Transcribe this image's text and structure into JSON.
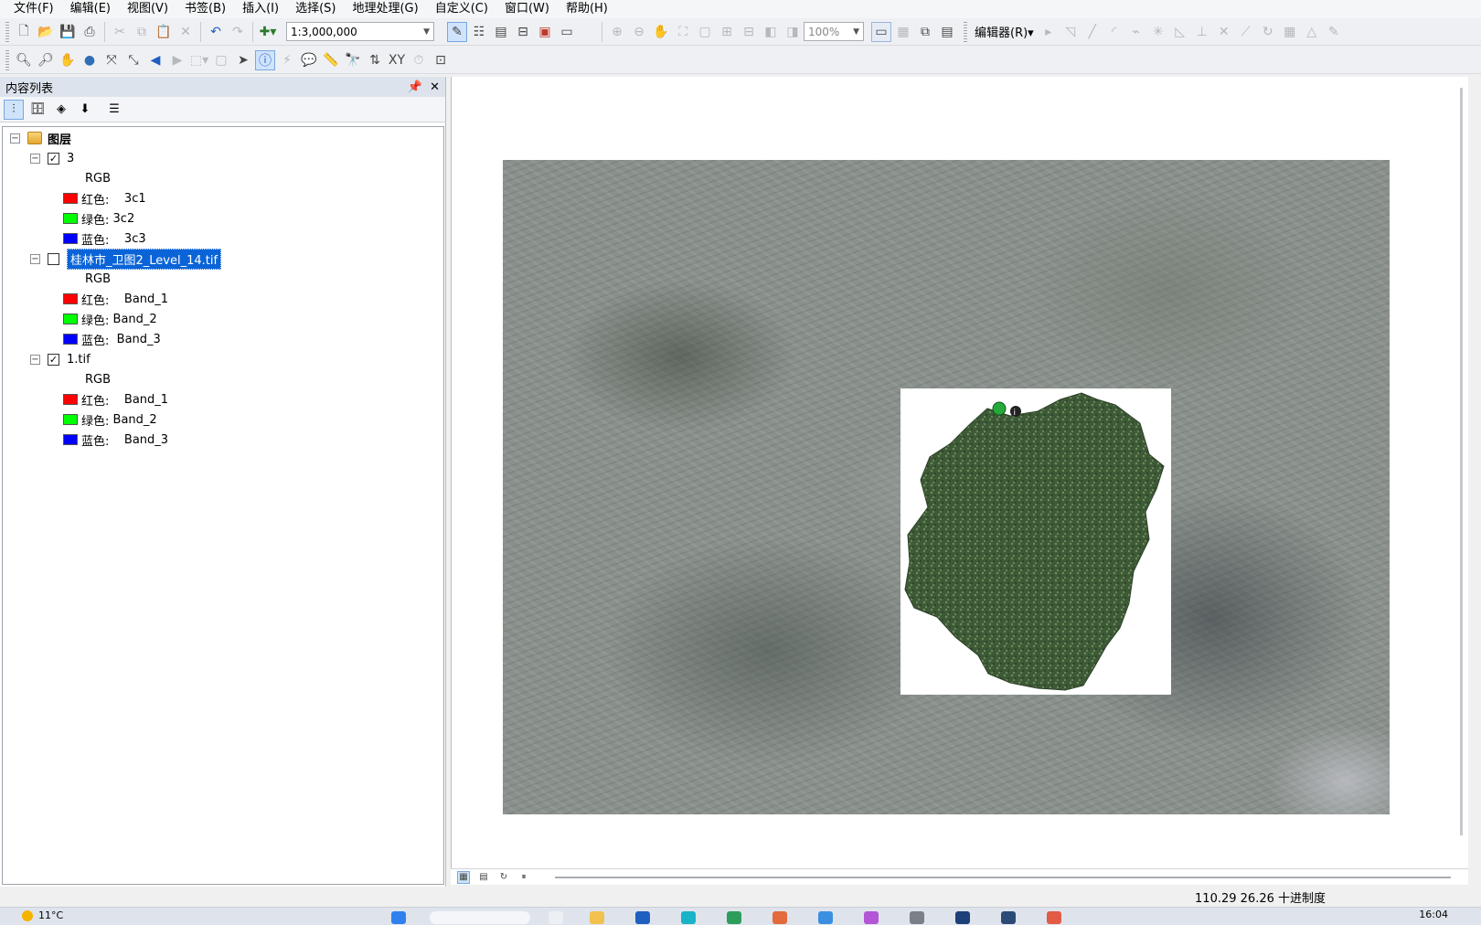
{
  "menu": [
    "文件(F)",
    "编辑(E)",
    "视图(V)",
    "书签(B)",
    "插入(I)",
    "选择(S)",
    "地理处理(G)",
    "自定义(C)",
    "窗口(W)",
    "帮助(H)"
  ],
  "toolbar": {
    "scale_value": "1:3,000,000",
    "zoom_value": "100%",
    "editor_label": "编辑器(R)▾"
  },
  "toc": {
    "title": "内容列表",
    "root_label": "图层",
    "layers": [
      {
        "name": "3",
        "checked": true,
        "selected": false,
        "rgb_label": "RGB",
        "bands": [
          {
            "channel": "红色:",
            "band": "3c1",
            "color": "#ff0000"
          },
          {
            "channel": "绿色:",
            "band": "3c2",
            "color": "#00ff00"
          },
          {
            "channel": "蓝色:",
            "band": "3c3",
            "color": "#0000ff"
          }
        ]
      },
      {
        "name": "桂林市_卫图2_Level_14.tif",
        "checked": false,
        "selected": true,
        "rgb_label": "RGB",
        "bands": [
          {
            "channel": "红色:",
            "band": "Band_1",
            "color": "#ff0000"
          },
          {
            "channel": "绿色:",
            "band": "Band_2",
            "color": "#00ff00"
          },
          {
            "channel": "蓝色:",
            "band": "Band_3",
            "color": "#0000ff"
          }
        ]
      },
      {
        "name": "1.tif",
        "checked": true,
        "selected": false,
        "rgb_label": "RGB",
        "bands": [
          {
            "channel": "红色:",
            "band": "Band_1",
            "color": "#ff0000"
          },
          {
            "channel": "绿色:",
            "band": "Band_2",
            "color": "#00ff00"
          },
          {
            "channel": "蓝色:",
            "band": "Band_3",
            "color": "#0000ff"
          }
        ]
      }
    ]
  },
  "status": {
    "coordinates": "110.29  26.26 十进制度"
  },
  "taskbar": {
    "weather": "11°C",
    "time": "16:04"
  }
}
